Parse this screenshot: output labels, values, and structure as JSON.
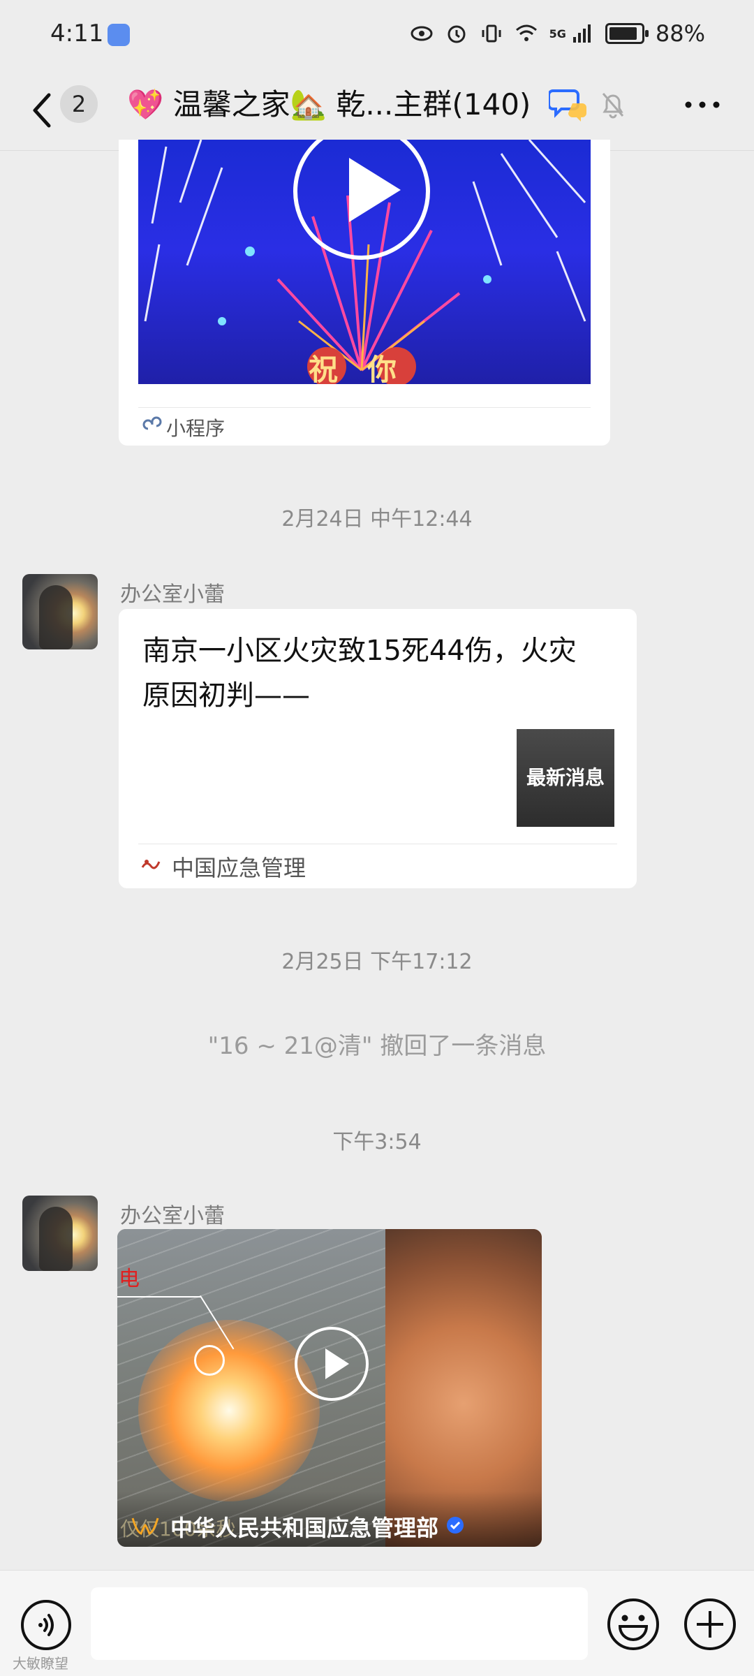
{
  "status_bar": {
    "time": "4:11",
    "network": "5G",
    "battery_text": "88%",
    "battery_level": 0.88
  },
  "header": {
    "unread_count": "2",
    "title_prefix_emoji": "💖",
    "title_text_1": "温馨之家",
    "title_house_emoji": "🏡",
    "title_text_2": "乾...主群(140)"
  },
  "messages": {
    "mini_program_card": {
      "label": "小程序",
      "overlay_text": "祝你"
    },
    "sep_1": "2月24日 中午12:44",
    "msg_1": {
      "sender": "办公室小蕾",
      "news_title": "南京一小区火灾致15死44伤，火灾原因初判——",
      "thumb_text": "最新消息",
      "source": "中国应急管理"
    },
    "sep_2": "2月25日 下午17:12",
    "system_notice": "\"16 ~ 21@清\" 撤回了一条消息",
    "sep_3": "下午3:54",
    "msg_2": {
      "sender": "办公室小蕾",
      "video_label": "电",
      "channel": "中华人民共和国应急管理部",
      "overlay_caption": "仅仅100余秒"
    }
  },
  "input_bar": {
    "placeholder": ""
  },
  "watermark": "大敏瞭望",
  "colors": {
    "background": "#ededed",
    "bubble": "#ffffff",
    "accent_blue": "#2b6cff",
    "fire_orange": "#ff9a3c"
  }
}
